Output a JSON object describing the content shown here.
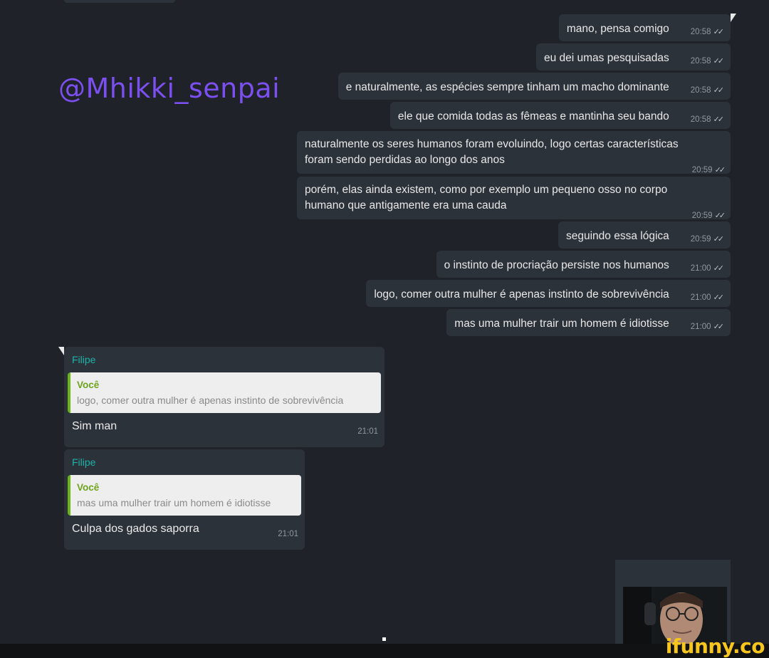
{
  "watermark": "@Mhikki_senpai",
  "outgoing": [
    {
      "text": "mano, pensa comigo",
      "time": "20:58"
    },
    {
      "text": "eu dei umas pesquisadas",
      "time": "20:58"
    },
    {
      "text": "e naturalmente, as espécies sempre tinham um macho dominante",
      "time": "20:58"
    },
    {
      "text": "ele que comida todas as fêmeas e mantinha seu bando",
      "time": "20:58"
    },
    {
      "line1": "naturalmente os seres humanos foram evoluindo, logo certas características",
      "line2": "foram sendo perdidas ao longo dos anos",
      "time": "20:59"
    },
    {
      "line1": "porém, elas ainda existem, como por exemplo um pequeno osso no corpo",
      "line2": "humano que antigamente era uma cauda",
      "time": "20:59"
    },
    {
      "text": "seguindo essa lógica",
      "time": "20:59"
    },
    {
      "text": "o instinto de procriação persiste nos humanos",
      "time": "21:00"
    },
    {
      "text": "logo, comer outra mulher é apenas instinto de sobrevivência",
      "time": "21:00"
    },
    {
      "text": "mas uma mulher trair um homem é idiotisse",
      "time": "21:00"
    }
  ],
  "incoming": [
    {
      "sender": "Filipe",
      "quote_author": "Você",
      "quote_text": "logo, comer outra mulher é apenas instinto de sobrevivência",
      "text": "Sim man",
      "time": "21:01"
    },
    {
      "sender": "Filipe",
      "quote_author": "Você",
      "quote_text": "mas uma mulher trair um homem é idiotisse",
      "text": "Culpa dos gados saporra",
      "time": "21:01"
    }
  ],
  "read_icon": "double-check-icon",
  "logo": "ifunny.co"
}
